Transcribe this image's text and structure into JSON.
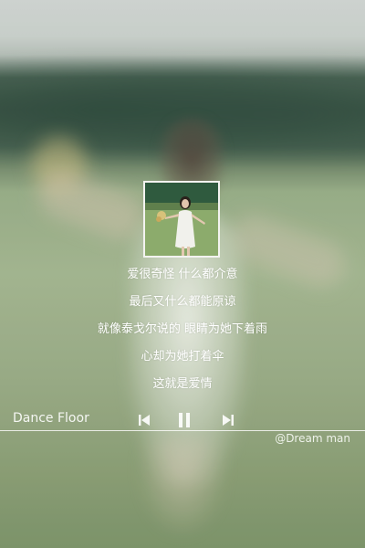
{
  "album": {
    "icon": "album-cover-girl-in-field"
  },
  "lyrics": [
    "爱很奇怪 什么都介意",
    "最后又什么都能原谅",
    "就像泰戈尔说的 眼睛为她下着雨",
    "心却为她打着伞",
    "这就是爱情"
  ],
  "player": {
    "track_title": "Dance Floor",
    "icons": {
      "prev": "skip-back-icon",
      "pause": "pause-icon",
      "next": "skip-forward-icon"
    }
  },
  "credit": "@Dream man",
  "colors": {
    "text": "#ffffff",
    "divider": "#ffffff",
    "accent_green": "#8fa27a"
  }
}
